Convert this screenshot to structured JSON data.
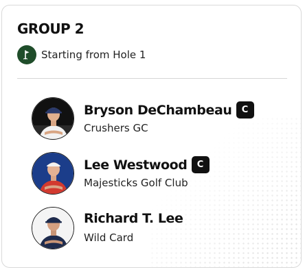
{
  "group": {
    "title": "GROUP 2",
    "start_text": "Starting from Hole 1",
    "flag_icon": "golf-flag-icon",
    "flag_color": "#1f4d2a"
  },
  "players": [
    {
      "name": "Bryson DeChambeau",
      "team": "Crushers GC",
      "captain": true,
      "captain_label": "C",
      "avatar_bg": "#111111",
      "shirt_color": "#f2f2f2"
    },
    {
      "name": "Lee Westwood",
      "team": "Majesticks Golf Club",
      "captain": true,
      "captain_label": "C",
      "avatar_bg": "#1b3d8a",
      "shirt_color": "#d23a2f"
    },
    {
      "name": "Richard T. Lee",
      "team": "Wild Card",
      "captain": false,
      "avatar_bg": "#f4f4f4",
      "shirt_color": "#1e2b4d"
    }
  ]
}
